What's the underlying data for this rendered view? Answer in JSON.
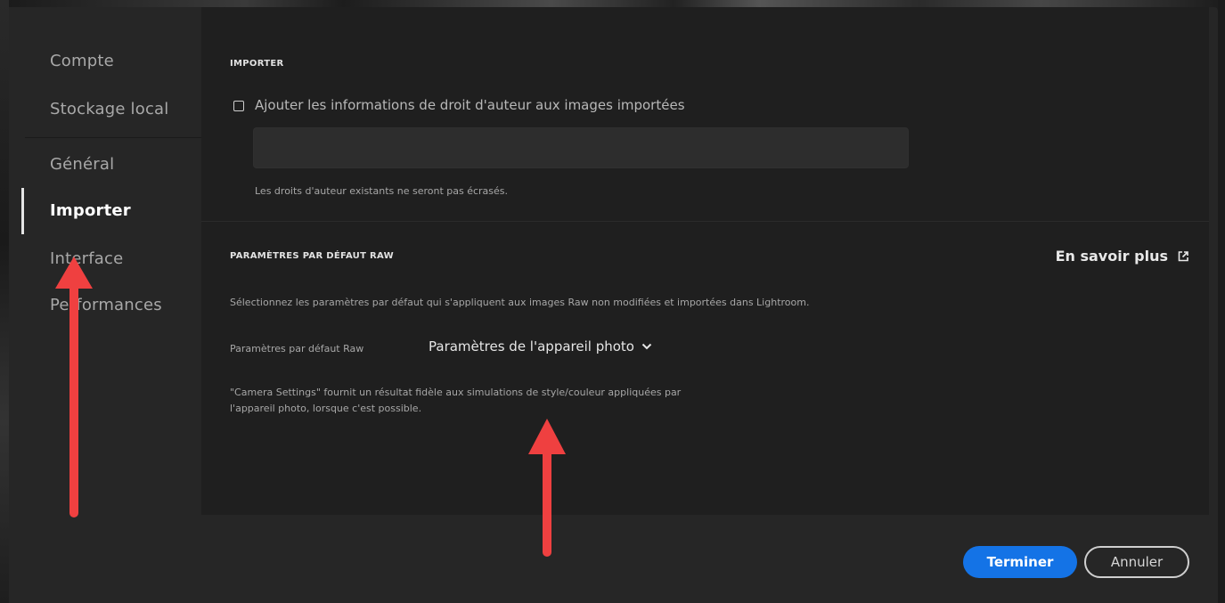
{
  "sidebar": {
    "items": [
      {
        "label": "Compte"
      },
      {
        "label": "Stockage local"
      },
      {
        "label": "Général"
      },
      {
        "label": "Importer"
      },
      {
        "label": "Interface"
      },
      {
        "label": "Performances"
      }
    ],
    "active_index": 3
  },
  "import_section": {
    "title": "IMPORTER",
    "copyright_checkbox_label": "Ajouter les informations de droit d'auteur aux images importées",
    "copyright_checked": false,
    "copyright_value": "",
    "note": "Les droits d'auteur existants ne seront pas écrasés."
  },
  "raw_section": {
    "title": "PARAMÈTRES PAR DÉFAUT RAW",
    "learn_more": "En savoir plus",
    "description": "Sélectionnez les paramètres par défaut qui s'appliquent aux images Raw non modifiées et importées dans Lightroom.",
    "setting_label": "Paramètres par défaut Raw",
    "setting_value": "Paramètres de l'appareil photo",
    "hint_line1": "\"Camera Settings\" fournit un résultat fidèle aux simulations de style/couleur appliquées par",
    "hint_line2": "l'appareil photo, lorsque c'est possible."
  },
  "footer": {
    "done_label": "Terminer",
    "cancel_label": "Annuler"
  },
  "colors": {
    "primary_button": "#1473e6",
    "annotation_arrow": "#ef4040"
  },
  "icons": {
    "learn_more": "external-link-icon",
    "dropdown": "chevron-down-icon",
    "annotation": "arrow-up-icon"
  }
}
